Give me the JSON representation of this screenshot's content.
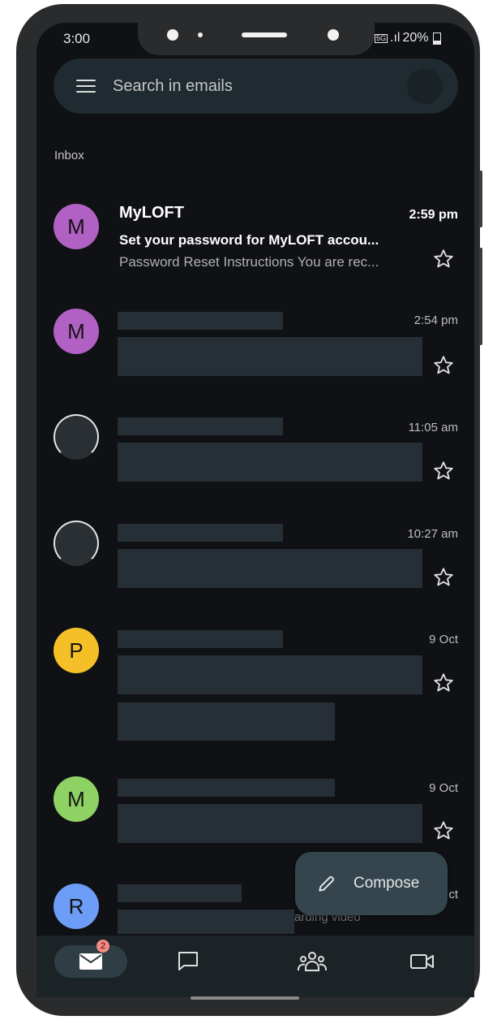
{
  "status_bar": {
    "time": "3:00",
    "network": "5G",
    "signal": ".ıl",
    "battery": "20%"
  },
  "search": {
    "placeholder": "Search in emails"
  },
  "folder_label": "Inbox",
  "emails": [
    {
      "avatar_letter": "M",
      "avatar_color": "#b161c4",
      "sender": "MyLOFT",
      "time": "2:59 pm",
      "subject": "Set your password for MyLOFT accou...",
      "snippet": "Password Reset Instructions You are rec...",
      "unread": true
    },
    {
      "avatar_letter": "M",
      "avatar_color": "#b161c4",
      "time": "2:54 pm"
    },
    {
      "avatar_letter": "",
      "avatar_color": "#2a2f33",
      "time": "11:05 am"
    },
    {
      "avatar_letter": "",
      "avatar_color": "#2a2f33",
      "time": "10:27 am"
    },
    {
      "avatar_letter": "P",
      "avatar_color": "#f5c027",
      "time": "9 Oct"
    },
    {
      "avatar_letter": "M",
      "avatar_color": "#8ed264",
      "time": "9 Oct"
    },
    {
      "avatar_letter": "R",
      "avatar_color": "#6d9df6",
      "time": "ct",
      "snippet_fragment": "arding video"
    }
  ],
  "compose": {
    "label": "Compose"
  },
  "bottom_nav": {
    "mail_badge": "2",
    "items": [
      "mail-icon",
      "chat-icon",
      "spaces-icon",
      "meet-icon"
    ]
  }
}
